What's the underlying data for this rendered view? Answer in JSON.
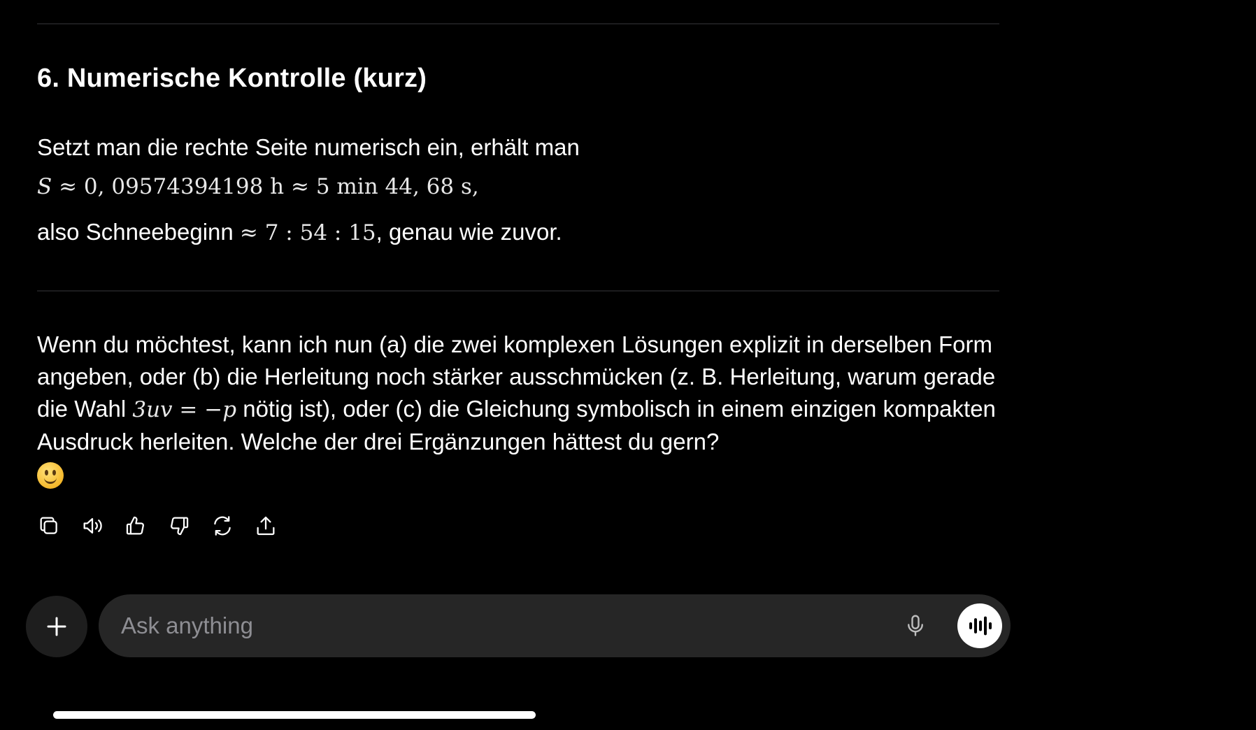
{
  "section": {
    "heading": "6. Numerische Kontrolle (kurz)",
    "intro": "Setzt man die rechte Seite numerisch ein, erhält man",
    "math_var": "S",
    "math_result": " ≈ 0, 09574394198 h ≈ 5 min 44, 68 s,",
    "conclusion_before": "also Schneebeginn ",
    "conclusion_math": "≈ 7 : 54 : 15",
    "conclusion_after": ", genau wie zuvor."
  },
  "followup": {
    "text_before": "Wenn du möchtest, kann ich nun (a) die zwei komplexen Lösungen explizit in derselben Form angeben, oder (b) die Herleitung noch stärker ausschmücken (z. B. Herleitung, warum gerade die Wahl ",
    "math": "3uv = −p",
    "text_after": " nötig ist), oder (c) die Gleichung symbolisch in einem einzigen kompakten Ausdruck herleiten. Welche der drei Ergänzungen hättest du gern?",
    "emoji": "slightly-smiling-face"
  },
  "actions": [
    {
      "icon": "copy-icon"
    },
    {
      "icon": "speaker-icon"
    },
    {
      "icon": "thumbs-up-icon"
    },
    {
      "icon": "thumbs-down-icon"
    },
    {
      "icon": "regenerate-icon"
    },
    {
      "icon": "share-icon"
    }
  ],
  "composer": {
    "placeholder": "Ask anything",
    "plus_icon": "plus-icon",
    "mic_icon": "microphone-icon",
    "voice_icon": "voice-mode-icon"
  },
  "colors": {
    "background": "#000000",
    "text": "#ffffff",
    "input_bg": "#262626",
    "placeholder": "#8e8e93"
  }
}
